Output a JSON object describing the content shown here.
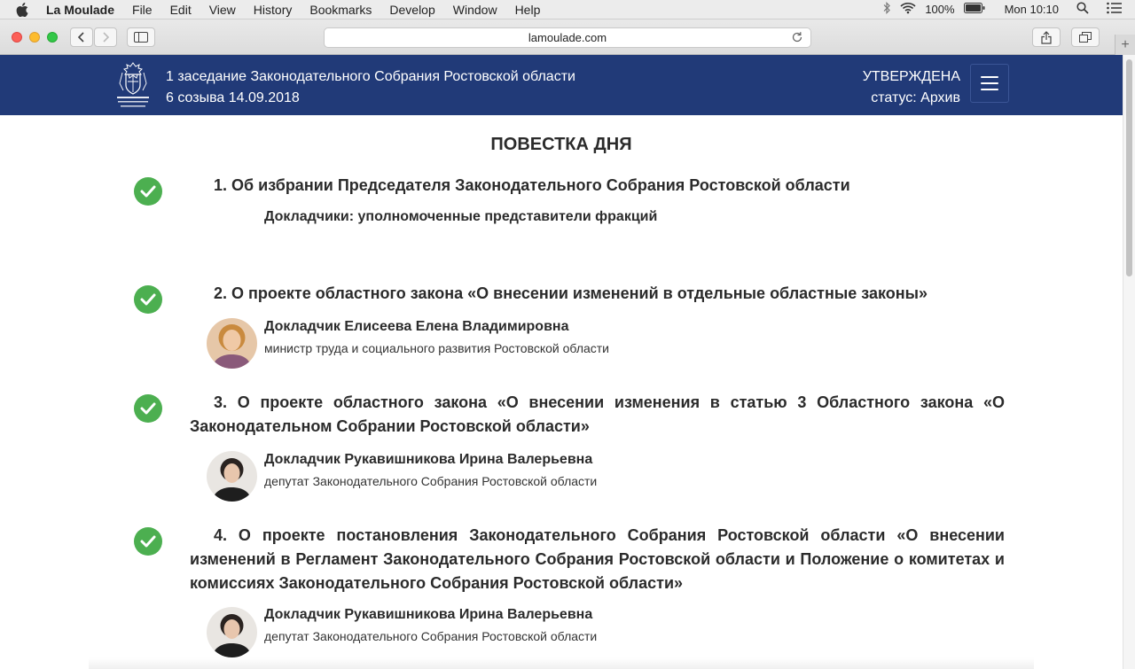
{
  "menubar": {
    "app_name": "La Moulade",
    "menus": [
      "File",
      "Edit",
      "View",
      "History",
      "Bookmarks",
      "Develop",
      "Window",
      "Help"
    ],
    "battery": "100%",
    "clock": "Mon 10:10"
  },
  "browser": {
    "url": "lamoulade.com"
  },
  "header": {
    "title_line1": "1 заседание Законодательного Собрания Ростовской области",
    "title_line2": "6 созыва 14.09.2018",
    "status_label": "УТВЕРЖДЕНА",
    "status_value": "статус: Архив",
    "logo_text": "ЗАКОНОДАТЕЛЬНОЕ СОБРАНИЕ Ростовской области"
  },
  "agenda": {
    "title": "ПОВЕСТКА ДНЯ",
    "items": [
      {
        "title": "1. Об избрании Председателя Законодательного Собрания Ростовской области",
        "speakers_note": "Докладчики: уполномоченные представители фракций"
      },
      {
        "title": "2. О проекте областного закона «О внесении изменений в отдельные областные законы»",
        "speaker_prefix": "Докладчик",
        "speaker_name": "Елисеева Елена Владимировна",
        "speaker_role": "министр труда и социального развития Ростовской области"
      },
      {
        "title": "3. О проекте областного закона «О внесении изменения в статью 3 Областного закона «О Законодательном Собрании Ростовской области»",
        "speaker_prefix": "Докладчик",
        "speaker_name": "Рукавишникова Ирина Валерьевна",
        "speaker_role": "депутат Законодательного Собрания Ростовской области"
      },
      {
        "title": "4. О проекте постановления Законодательного Собрания Ростовской области «О внесении изменений в Регламент Законодательного Собрания Ростовской области и Положение о комитетах и комиссиях Законодательного Собрания Ростовской области»",
        "speaker_prefix": "Докладчик",
        "speaker_name": "Рукавишникова Ирина Валерьевна",
        "speaker_role": "депутат Законодательного Собрания Ростовской области"
      }
    ]
  },
  "colors": {
    "header_bg": "#213a78",
    "check_green": "#4caf50"
  }
}
